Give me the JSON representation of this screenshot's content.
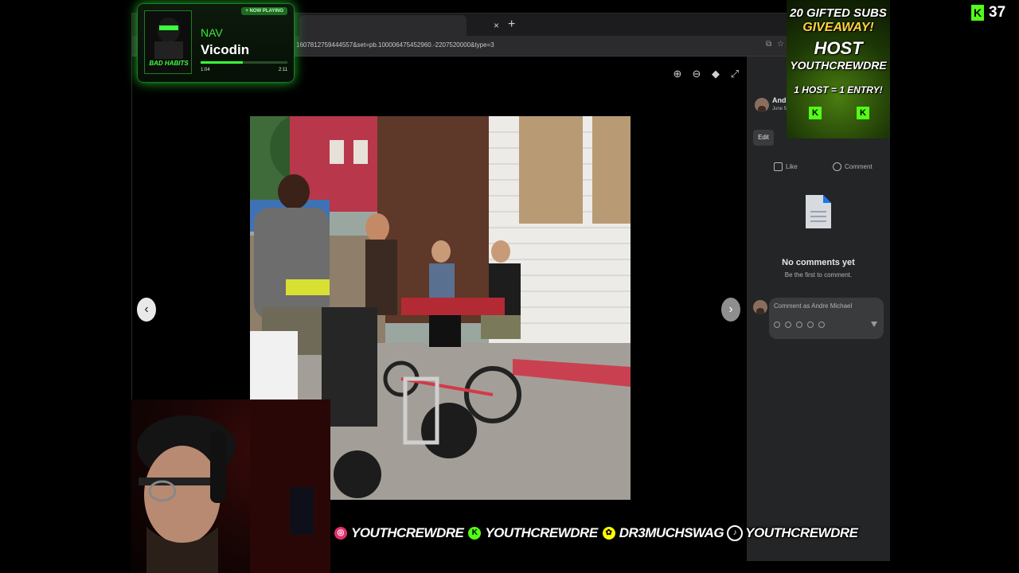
{
  "browser": {
    "url": "1607812759444557&set=pb.100006475452960.-2207520000&type=3",
    "tab_close": "×",
    "tab_new": "+"
  },
  "viewer": {
    "prev_icon": "‹",
    "next_icon": "›",
    "tools": [
      "zoom-in-icon",
      "zoom-out-icon",
      "tag-icon",
      "fullscreen-icon"
    ]
  },
  "panel": {
    "poster_name": "Andre",
    "post_date": "June 5",
    "edit_label": "Edit",
    "like_label": "Like",
    "comment_label": "Comment",
    "no_comments_title": "No comments yet",
    "no_comments_sub": "Be the first to comment.",
    "comment_placeholder": "Comment as Andre Michael"
  },
  "now_playing": {
    "badge": "+ NOW PLAYING",
    "artist": "NAV",
    "track": "Vicodin",
    "cover_title": "BAD HABITS",
    "elapsed": "1:04",
    "duration": "2:11",
    "progress": 0.49
  },
  "giveaway": {
    "line1": "20 GIFTED SUBS",
    "line2": "GIVEAWAY!",
    "line3": "HOST",
    "line4": "YOUTHCREWDRE",
    "line5": "1 HOST = 1 ENTRY!",
    "k1": "K",
    "k2": "K"
  },
  "kick": {
    "logo": "K",
    "viewer_count": "37"
  },
  "social": [
    {
      "icon": "instagram-icon",
      "glyph": "◎",
      "handle": "YOUTHCREWDRE"
    },
    {
      "icon": "kick-icon",
      "glyph": "K",
      "handle": "YOUTHCREWDRE"
    },
    {
      "icon": "snapchat-icon",
      "glyph": "✿",
      "handle": "DR3MUCHSWAG"
    },
    {
      "icon": "tiktok-icon",
      "glyph": "♪",
      "handle": "YOUTHCREWDRE"
    }
  ],
  "colors": {
    "accent_green": "#53fc18",
    "panel_bg": "#242526",
    "overlay_glow": "#1fae2a"
  }
}
